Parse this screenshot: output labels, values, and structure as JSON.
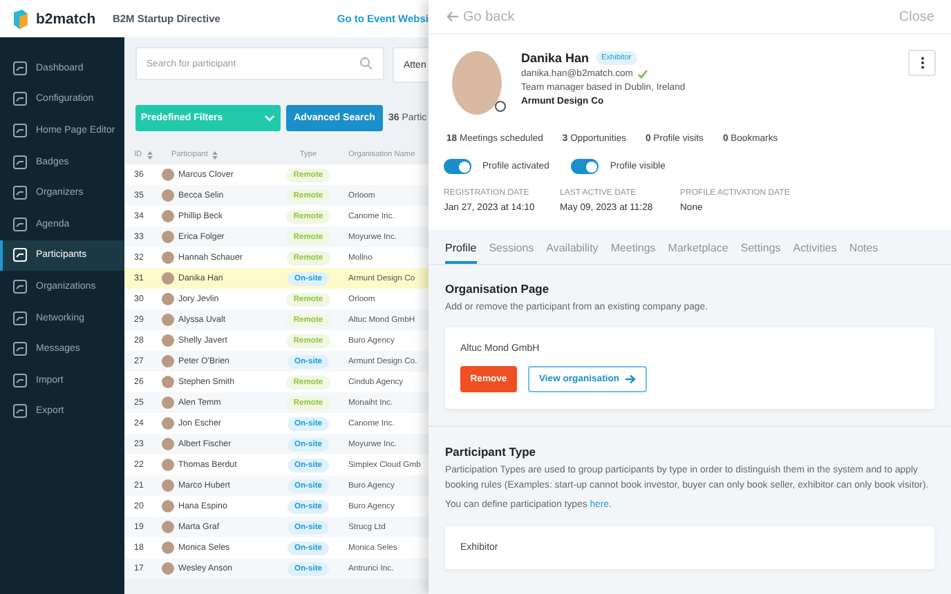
{
  "header": {
    "logo": "b2match",
    "event": "B2M Startup Directive",
    "link": "Go to Event Websi"
  },
  "sidebar": {
    "items": [
      {
        "label": "Dashboard",
        "selected": false
      },
      {
        "label": "Configuration",
        "selected": false
      },
      {
        "label": "Home Page Editor",
        "selected": false
      },
      {
        "label": "Badges",
        "selected": false
      },
      {
        "label": "Organizers",
        "selected": false
      },
      {
        "label": "Agenda",
        "selected": false
      },
      {
        "label": "Participants",
        "selected": true
      },
      {
        "label": "Organizations",
        "selected": false
      },
      {
        "label": "Networking",
        "selected": false
      },
      {
        "label": "Messages",
        "selected": false
      },
      {
        "label": "Import",
        "selected": false
      },
      {
        "label": "Export",
        "selected": false
      }
    ]
  },
  "toolbar": {
    "search": {
      "placeholder": "Search for participant"
    },
    "filter": {
      "value": "Atten"
    },
    "predefined_filters": "Predefined Filters",
    "advanced_search": "Advanced Search",
    "count": "**36** Partic"
  },
  "table": {
    "columns": [
      {
        "label": "ID",
        "sortable": true
      },
      {
        "label": "Participant",
        "sortable": true
      },
      {
        "label": "Type",
        "sortable": false
      },
      {
        "label": "Organisation Name",
        "sortable": false
      }
    ],
    "rows": [
      {
        "id": "36",
        "name": "Marcus Clover",
        "type": "Remote",
        "kind": "remote",
        "organisation": "",
        "selected": false
      },
      {
        "id": "35",
        "name": "Becca Selin",
        "type": "Remote",
        "kind": "remote",
        "organisation": "Orloom",
        "selected": false
      },
      {
        "id": "34",
        "name": "Phillip Beck",
        "type": "Remote",
        "kind": "remote",
        "organisation": "Canome Inc.",
        "selected": false
      },
      {
        "id": "33",
        "name": "Erica Folger",
        "type": "Remote",
        "kind": "remote",
        "organisation": "Moyurwe Inc.",
        "selected": false
      },
      {
        "id": "32",
        "name": "Hannah Schauer",
        "type": "Remote",
        "kind": "remote",
        "organisation": "Mollno",
        "selected": false
      },
      {
        "id": "31",
        "name": "Danika Han",
        "type": "On-site",
        "kind": "onsite",
        "organisation": "Armunt Design Co",
        "selected": true
      },
      {
        "id": "30",
        "name": "Jory Jevlin",
        "type": "Remote",
        "kind": "remote",
        "organisation": "Orloom",
        "selected": false
      },
      {
        "id": "29",
        "name": "Alyssa Uvalt",
        "type": "Remote",
        "kind": "remote",
        "organisation": "Altuc Mond GmbH",
        "selected": false
      },
      {
        "id": "28",
        "name": "Shelly Javert",
        "type": "Remote",
        "kind": "remote",
        "organisation": "Buro Agency",
        "selected": false
      },
      {
        "id": "27",
        "name": "Peter O'Brien",
        "type": "On-site",
        "kind": "onsite",
        "organisation": "Armunt Design Co.",
        "selected": false
      },
      {
        "id": "26",
        "name": "Stephen Smith",
        "type": "Remote",
        "kind": "remote",
        "organisation": "Cindub Agency",
        "selected": false
      },
      {
        "id": "25",
        "name": "Alen Temm",
        "type": "Remote",
        "kind": "remote",
        "organisation": "Monaiht Inc.",
        "selected": false
      },
      {
        "id": "24",
        "name": "Jon Escher",
        "type": "On-site",
        "kind": "onsite",
        "organisation": "Canome Inc.",
        "selected": false
      },
      {
        "id": "23",
        "name": "Albert Fischer",
        "type": "On-site",
        "kind": "onsite",
        "organisation": "Moyurwe Inc.",
        "selected": false
      },
      {
        "id": "22",
        "name": "Thomas Berdut",
        "type": "On-site",
        "kind": "onsite",
        "organisation": "Simplex Cloud Gmb",
        "selected": false
      },
      {
        "id": "21",
        "name": "Marco Hubert",
        "type": "On-site",
        "kind": "onsite",
        "organisation": "Buro Agency",
        "selected": false
      },
      {
        "id": "20",
        "name": "Hana Espino",
        "type": "On-site",
        "kind": "onsite",
        "organisation": "Buro Agency",
        "selected": false
      },
      {
        "id": "19",
        "name": "Marta Graf",
        "type": "On-site",
        "kind": "onsite",
        "organisation": "Strucg Ltd",
        "selected": false
      },
      {
        "id": "18",
        "name": "Monica Seles",
        "type": "On-site",
        "kind": "onsite",
        "organisation": "Monica Seles",
        "selected": false
      },
      {
        "id": "17",
        "name": "Wesley Anson",
        "type": "On-site",
        "kind": "onsite",
        "organisation": "Antrunci Inc.",
        "selected": false
      }
    ]
  },
  "panel": {
    "back": "Go back",
    "close": "Close",
    "profile": {
      "name": "Danika Han",
      "badge": "Exhibitor",
      "email": "danika.han@b2match.com",
      "verified": true,
      "description": "Team manager based in Dublin, Ireland",
      "company": "Armunt Design Co"
    },
    "stats": [
      "**18** Meetings scheduled",
      "**3** Opportunities",
      "**0** Profile visits",
      "**0** Bookmarks"
    ],
    "toggles": [
      {
        "label": "Profile activated",
        "on": true
      },
      {
        "label": "Profile visible",
        "on": true
      }
    ],
    "dates": [
      {
        "label": "REGISTRATION DATE",
        "value": "Jan 27, 2023 at 14:10"
      },
      {
        "label": "LAST ACTIVE DATE",
        "value": "May 09, 2023 at 11:28"
      },
      {
        "label": "PROFILE ACTIVATION DATE",
        "value": "None"
      }
    ],
    "tabs": [
      {
        "label": "Profile",
        "selected": true
      },
      {
        "label": "Sessions",
        "selected": false
      },
      {
        "label": "Availability",
        "selected": false
      },
      {
        "label": "Meetings",
        "selected": false
      },
      {
        "label": "Marketplace",
        "selected": false
      },
      {
        "label": "Settings",
        "selected": false
      },
      {
        "label": "Activities",
        "selected": false
      },
      {
        "label": "Notes",
        "selected": false
      }
    ],
    "organisation_page": {
      "title": "Organisation Page",
      "description": "Add or remove the participant from an existing company page.",
      "organisation": "Altuc Mond GmbH",
      "remove": "Remove",
      "view": "View organisation"
    },
    "participant_type": {
      "title": "Participant Type",
      "description": "Participation Types are used to group participants by type in order to distinguish them in the system and to apply booking rules (Examples: start-up cannot book investor, buyer can only book seller, exhibitor can only book visitor).",
      "define_text": "You can define participation types",
      "define_link": "here",
      "define_end": ".",
      "type": "Exhibitor"
    }
  }
}
